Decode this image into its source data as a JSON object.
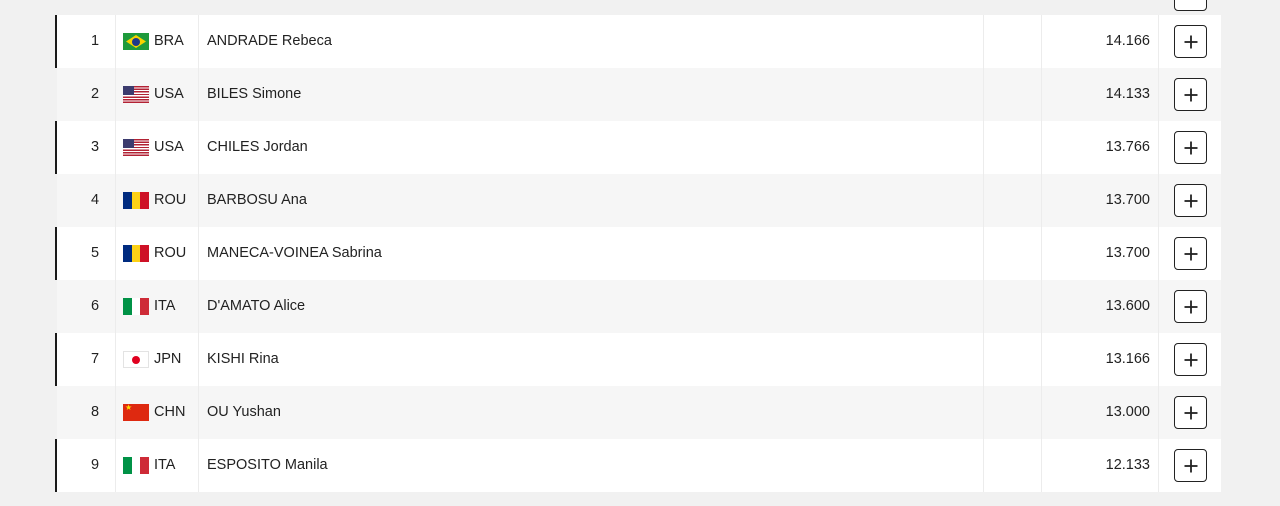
{
  "results": {
    "rows": [
      {
        "rank": "1",
        "noc": "BRA",
        "flag": "bra",
        "name": "ANDRADE Rebeca",
        "score": "14.166",
        "expand": "+"
      },
      {
        "rank": "2",
        "noc": "USA",
        "flag": "usa",
        "name": "BILES Simone",
        "score": "14.133",
        "expand": "+"
      },
      {
        "rank": "3",
        "noc": "USA",
        "flag": "usa",
        "name": "CHILES Jordan",
        "score": "13.766",
        "expand": "+"
      },
      {
        "rank": "4",
        "noc": "ROU",
        "flag": "rou",
        "name": "BARBOSU Ana",
        "score": "13.700",
        "expand": "+"
      },
      {
        "rank": "5",
        "noc": "ROU",
        "flag": "rou",
        "name": "MANECA-VOINEA Sabrina",
        "score": "13.700",
        "expand": "+"
      },
      {
        "rank": "6",
        "noc": "ITA",
        "flag": "ita",
        "name": "D'AMATO Alice",
        "score": "13.600",
        "expand": "+"
      },
      {
        "rank": "7",
        "noc": "JPN",
        "flag": "jpn",
        "name": "KISHI Rina",
        "score": "13.166",
        "expand": "+"
      },
      {
        "rank": "8",
        "noc": "CHN",
        "flag": "chn",
        "name": "OU Yushan",
        "score": "13.000",
        "expand": "+"
      },
      {
        "rank": "9",
        "noc": "ITA",
        "flag": "ita",
        "name": "ESPOSITO Manila",
        "score": "12.133",
        "expand": "+"
      }
    ]
  },
  "colors": {
    "accent_bar": "#1a1a1a",
    "row_white": "#ffffff",
    "row_grey": "#f6f6f6",
    "page_bg": "#f1f1f1"
  }
}
